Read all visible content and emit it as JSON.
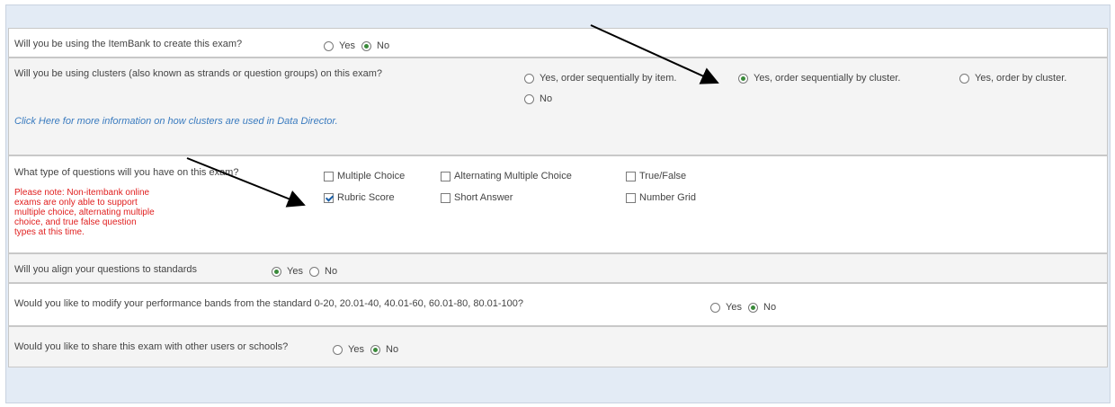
{
  "questions": {
    "itembank": {
      "text": "Will you be using the ItemBank to create this exam?",
      "options": [
        {
          "label": "Yes",
          "selected": false
        },
        {
          "label": "No",
          "selected": true
        }
      ]
    },
    "clusters": {
      "text": "Will you be using clusters (also known as strands or question groups) on this exam?",
      "options": [
        {
          "label": "Yes, order sequentially by item.",
          "selected": false
        },
        {
          "label": "Yes, order sequentially by cluster.",
          "selected": true
        },
        {
          "label": "Yes, order by cluster.",
          "selected": false
        },
        {
          "label": "No",
          "selected": false
        }
      ],
      "link": "Click Here for more information on how clusters are used in Data Director."
    },
    "types": {
      "text": "What type of questions will you have on this exam?",
      "note": "Please note: Non-itembank online exams are only able to support multiple choice, alternating multiple choice, and true false question types at this time.",
      "options": [
        {
          "label": "Multiple Choice",
          "checked": false
        },
        {
          "label": "Alternating Multiple Choice",
          "checked": false
        },
        {
          "label": "True/False",
          "checked": false
        },
        {
          "label": "Rubric Score",
          "checked": true
        },
        {
          "label": "Short Answer",
          "checked": false
        },
        {
          "label": "Number Grid",
          "checked": false
        }
      ]
    },
    "standards": {
      "text": "Will you align your questions to standards",
      "options": [
        {
          "label": "Yes",
          "selected": true
        },
        {
          "label": "No",
          "selected": false
        }
      ]
    },
    "bands": {
      "text": "Would you like to modify your performance bands from the standard 0-20, 20.01-40, 40.01-60, 60.01-80, 80.01-100?",
      "options": [
        {
          "label": "Yes",
          "selected": false
        },
        {
          "label": "No",
          "selected": true
        }
      ]
    },
    "share": {
      "text": "Would you like to share this exam with other users or schools?",
      "options": [
        {
          "label": "Yes",
          "selected": false
        },
        {
          "label": "No",
          "selected": true
        }
      ]
    }
  },
  "colors": {
    "panel": "#e3ebf5",
    "note": "#e02020",
    "link": "#3a7bbf",
    "radio_dot": "#3a8a3a"
  }
}
